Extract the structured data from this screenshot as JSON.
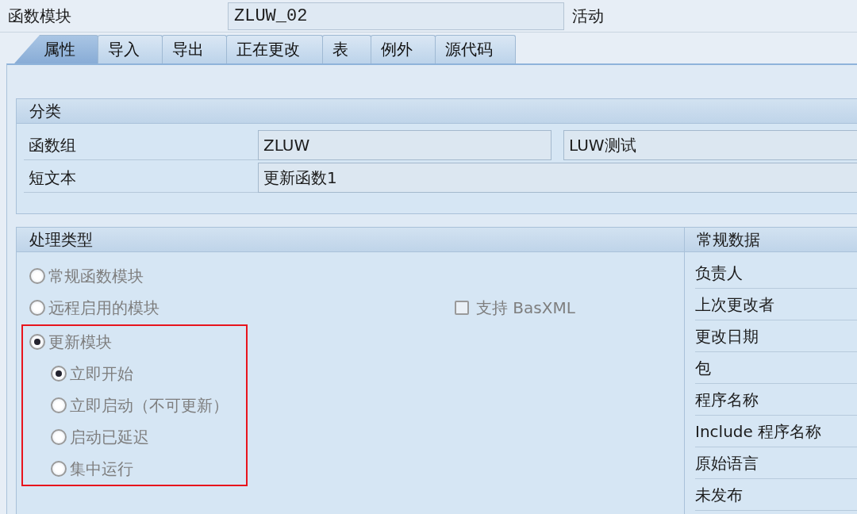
{
  "header": {
    "label": "函数模块",
    "value": "ZLUW_02",
    "status": "活动"
  },
  "tabs": [
    {
      "label": "属性",
      "selected": true
    },
    {
      "label": "导入",
      "selected": false
    },
    {
      "label": "导出",
      "selected": false
    },
    {
      "label": "正在更改",
      "selected": false
    },
    {
      "label": "表",
      "selected": false
    },
    {
      "label": "例外",
      "selected": false
    },
    {
      "label": "源代码",
      "selected": false
    }
  ],
  "classification": {
    "title": "分类",
    "rows": [
      {
        "label": "函数组",
        "values": [
          "ZLUW",
          "LUW测试"
        ]
      },
      {
        "label": "短文本",
        "values": [
          "更新函数1"
        ]
      }
    ]
  },
  "processing_type": {
    "title": "处理类型",
    "options": [
      {
        "label": "常规函数模块",
        "selected": false,
        "disabled": true,
        "highlighted": false
      },
      {
        "label": "远程启用的模块",
        "selected": false,
        "disabled": true,
        "highlighted": false
      },
      {
        "label": "更新模块",
        "selected": true,
        "disabled": true,
        "highlighted": true,
        "children": [
          {
            "label": "立即开始",
            "selected": true,
            "disabled": true
          },
          {
            "label": "立即启动（不可更新）",
            "selected": false,
            "disabled": true
          },
          {
            "label": "启动已延迟",
            "selected": false,
            "disabled": true
          },
          {
            "label": "集中运行",
            "selected": false,
            "disabled": true
          }
        ]
      }
    ],
    "checkbox": {
      "label": "支持 BasXML",
      "checked": false,
      "disabled": true
    }
  },
  "general_data": {
    "title": "常规数据",
    "labels": [
      "负责人",
      "上次更改者",
      "更改日期",
      "包",
      "程序名称",
      "Include 程序名称",
      "原始语言",
      "未发布"
    ]
  }
}
